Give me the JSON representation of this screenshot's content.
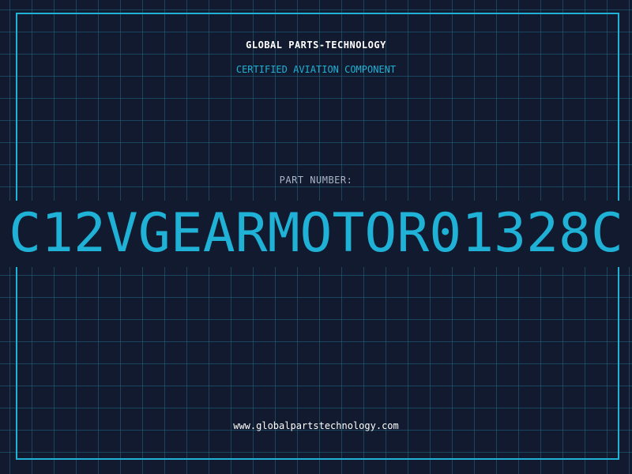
{
  "header": {
    "company": "GLOBAL PARTS-TECHNOLOGY",
    "subtitle": "CERTIFIED AVIATION COMPONENT"
  },
  "part": {
    "label": "PART NUMBER:",
    "number": "C12VGEARMOTOR01328C"
  },
  "footer": {
    "url": "www.globalpartstechnology.com"
  },
  "colors": {
    "background": "#111a2e",
    "accent": "#1fb1d6",
    "text": "#ffffff",
    "muted": "#aab6c8"
  }
}
